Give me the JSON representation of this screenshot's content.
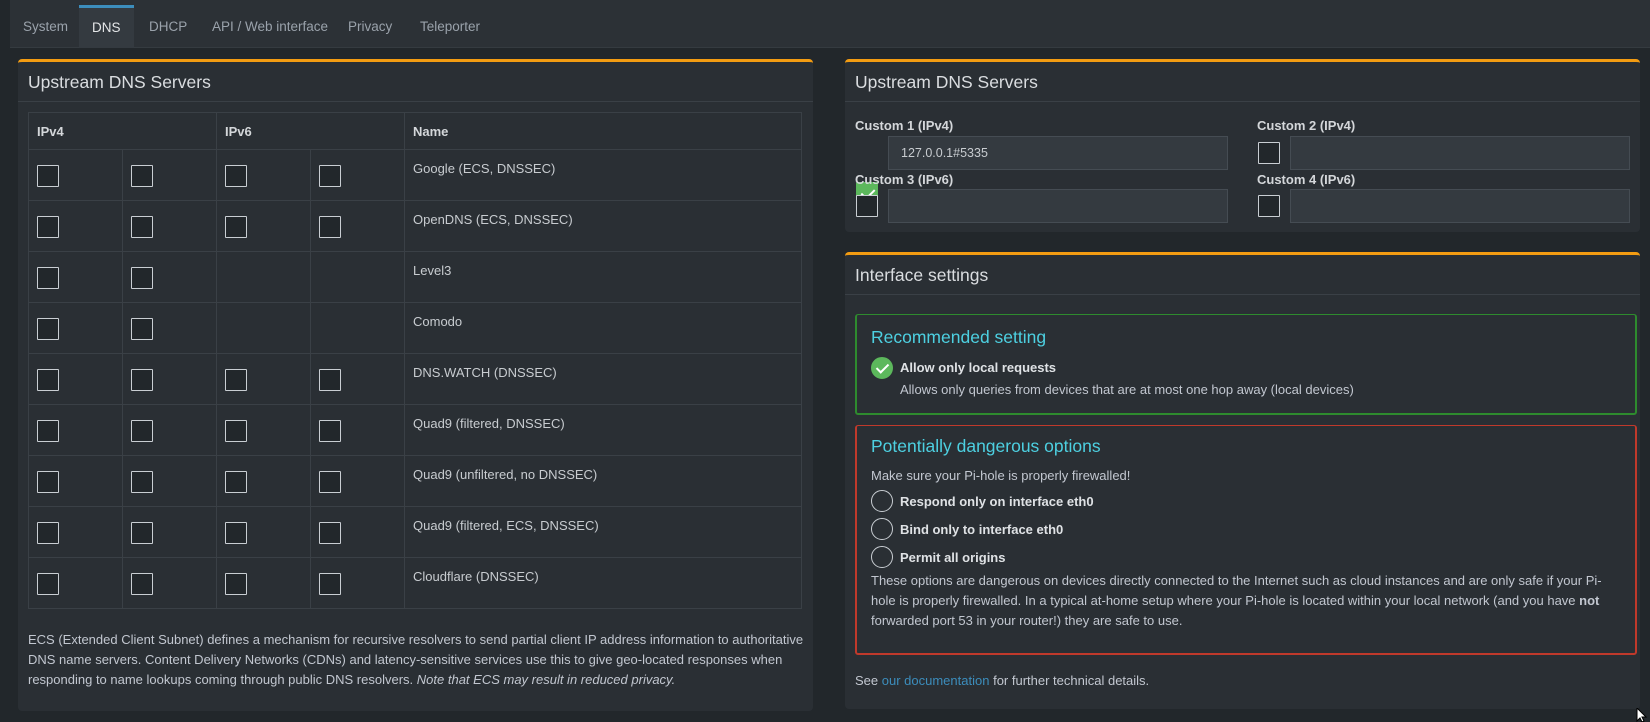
{
  "tabs": [
    {
      "label": "System",
      "active": false
    },
    {
      "label": "DNS",
      "active": true
    },
    {
      "label": "DHCP",
      "active": false
    },
    {
      "label": "API / Web interface",
      "active": false
    },
    {
      "label": "Privacy",
      "active": false
    },
    {
      "label": "Teleporter",
      "active": false
    }
  ],
  "upstream": {
    "title": "Upstream DNS Servers",
    "columns": {
      "ipv4": "IPv4",
      "ipv6": "IPv6",
      "name": "Name"
    },
    "servers": [
      {
        "name": "Google (ECS, DNSSEC)",
        "ipv4": [
          false,
          false
        ],
        "ipv6": [
          false,
          false
        ]
      },
      {
        "name": "OpenDNS (ECS, DNSSEC)",
        "ipv4": [
          false,
          false
        ],
        "ipv6": [
          false,
          false
        ]
      },
      {
        "name": "Level3",
        "ipv4": [
          false,
          false
        ],
        "ipv6": null
      },
      {
        "name": "Comodo",
        "ipv4": [
          false,
          false
        ],
        "ipv6": null
      },
      {
        "name": "DNS.WATCH (DNSSEC)",
        "ipv4": [
          false,
          false
        ],
        "ipv6": [
          false,
          false
        ]
      },
      {
        "name": "Quad9 (filtered, DNSSEC)",
        "ipv4": [
          false,
          false
        ],
        "ipv6": [
          false,
          false
        ]
      },
      {
        "name": "Quad9 (unfiltered, no DNSSEC)",
        "ipv4": [
          false,
          false
        ],
        "ipv6": [
          false,
          false
        ]
      },
      {
        "name": "Quad9 (filtered, ECS, DNSSEC)",
        "ipv4": [
          false,
          false
        ],
        "ipv6": [
          false,
          false
        ]
      },
      {
        "name": "Cloudflare (DNSSEC)",
        "ipv4": [
          false,
          false
        ],
        "ipv6": [
          false,
          false
        ]
      }
    ],
    "ecs_note": "ECS (Extended Client Subnet) defines a mechanism for recursive resolvers to send partial client IP address information to authoritative DNS name servers. Content Delivery Networks (CDNs) and latency-sensitive services use this to give geo-located responses when responding to name lookups coming through public DNS resolvers.",
    "ecs_note_italic": "Note that ECS may result in reduced privacy."
  },
  "custom": {
    "title": "Upstream DNS Servers",
    "fields": [
      {
        "label": "Custom 1 (IPv4)",
        "checked": true,
        "value": "127.0.0.1#5335"
      },
      {
        "label": "Custom 2 (IPv4)",
        "checked": false,
        "value": ""
      },
      {
        "label": "Custom 3 (IPv6)",
        "checked": false,
        "value": ""
      },
      {
        "label": "Custom 4 (IPv6)",
        "checked": false,
        "value": ""
      }
    ]
  },
  "interface": {
    "title": "Interface settings",
    "recommended": {
      "title": "Recommended setting",
      "option_label": "Allow only local requests",
      "option_desc": "Allows only queries from devices that are at most one hop away (local devices)"
    },
    "dangerous": {
      "title": "Potentially dangerous options",
      "warning": "Make sure your Pi-hole is properly firewalled!",
      "options": [
        "Respond only on interface eth0",
        "Bind only to interface eth0",
        "Permit all origins"
      ],
      "note_part1": "These options are dangerous on devices directly connected to the Internet such as cloud instances and are only safe if your Pi-hole is properly firewalled. In a typical at-home setup where your Pi-hole is located within your local network (and you have",
      "note_bold": "not",
      "note_part2": "forwarded port 53 in your router!) they are safe to use."
    },
    "footer_pre": "See",
    "footer_link": "our documentation",
    "footer_post": "for further technical details."
  },
  "colors": {
    "accent_orange": "#f39c12",
    "checked_green": "#5cb85c",
    "title_cyan": "#4dd0e1",
    "danger_red": "#c0392b",
    "link_blue": "#3c8dbc"
  },
  "icons": {
    "check": "check-icon",
    "cursor": "mouse-cursor-icon"
  }
}
